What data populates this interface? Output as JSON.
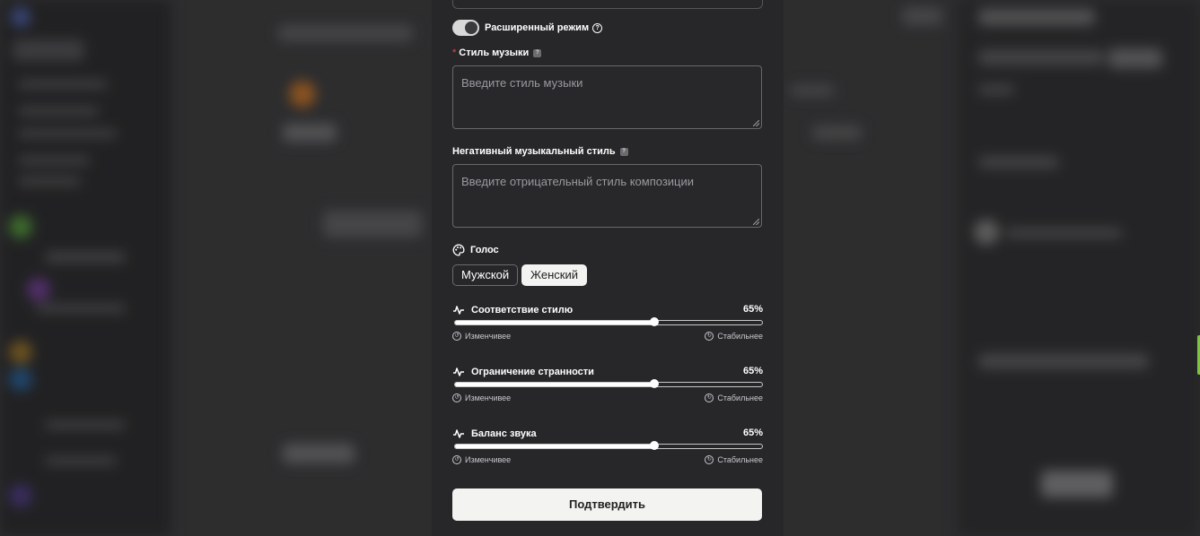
{
  "advanced_mode": {
    "label": "Расширенный режим",
    "enabled": true,
    "help_glyph": "?"
  },
  "music_style": {
    "label": "Стиль музыки",
    "required_mark": "*",
    "placeholder": "Введите стиль музыки",
    "value": "",
    "hint_glyph": "?"
  },
  "negative_style": {
    "label": "Негативный музыкальный стиль",
    "placeholder": "Введите отрицательный стиль композиции",
    "value": "",
    "hint_glyph": "?"
  },
  "voice": {
    "title": "Голос",
    "icon": "palette-icon",
    "options": [
      "Мужской",
      "Женский"
    ],
    "selected": "Женский"
  },
  "sliders": [
    {
      "label": "Соответствие стилю",
      "percent_text": "65%",
      "value": 0.65,
      "left_label": "Изменчивее",
      "right_label": "Стабильнее"
    },
    {
      "label": "Ограничение странности",
      "percent_text": "65%",
      "value": 0.65,
      "left_label": "Изменчивее",
      "right_label": "Стабильнее"
    },
    {
      "label": "Баланс звука",
      "percent_text": "65%",
      "value": 0.65,
      "left_label": "Изменчивее",
      "right_label": "Стабильнее"
    }
  ],
  "confirm_label": "Подтвердить",
  "colors": {
    "panel": "#27272a",
    "accent_light": "#f3f3f1",
    "required": "#e5484d",
    "edge_tab": "#7fc244"
  }
}
